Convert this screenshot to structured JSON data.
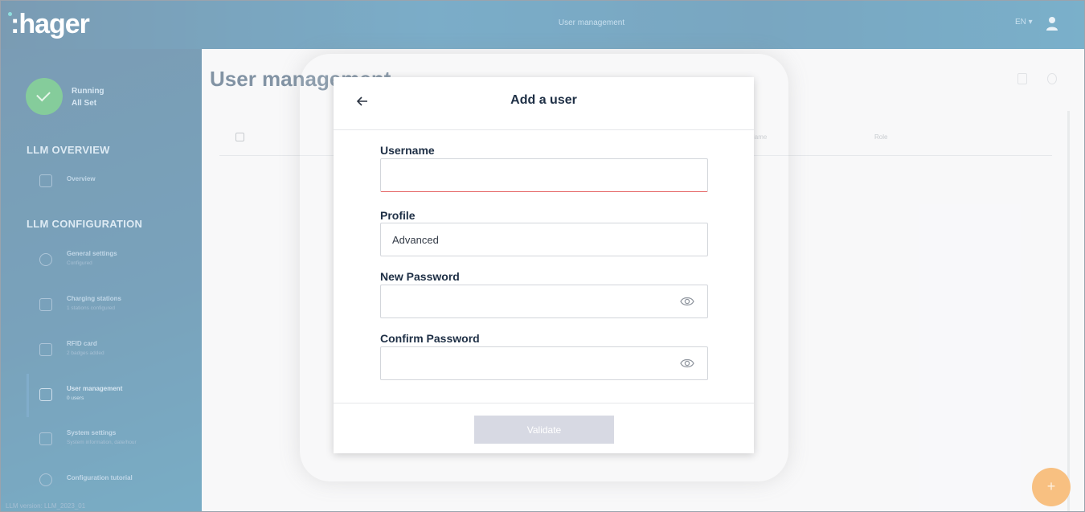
{
  "topbar": {
    "title": "User management",
    "lang": "EN ▾"
  },
  "sidebar": {
    "status": {
      "line1": "Running",
      "line2": "All Set"
    },
    "overview_section": "LLM OVERVIEW",
    "overview_item": "Overview",
    "config_section": "LLM CONFIGURATION",
    "items": [
      {
        "label": "General settings",
        "sub": "Configured"
      },
      {
        "label": "Charging stations",
        "sub": "1 stations configured"
      },
      {
        "label": "RFID card",
        "sub": "2 badges added"
      },
      {
        "label": "User management",
        "sub": "0 users"
      },
      {
        "label": "System settings",
        "sub": "System information, date/hour"
      },
      {
        "label": "Configuration tutorial",
        "sub": ""
      }
    ],
    "version": "LLM version: LLM_2023_01"
  },
  "main": {
    "title": "User management",
    "columns": {
      "name": "Name",
      "role": "Role"
    },
    "fab": "+"
  },
  "modal": {
    "title": "Add a user",
    "username_label": "Username",
    "username_value": "",
    "profile_label": "Profile",
    "profile_value": "Advanced",
    "new_password_label": "New Password",
    "confirm_password_label": "Confirm Password",
    "validate_label": "Validate"
  },
  "colors": {
    "brand": "#0d4a75",
    "status": "#22a34a",
    "fab": "#f28c1a",
    "error": "#e46363",
    "button_disabled": "#d7d9e3"
  }
}
